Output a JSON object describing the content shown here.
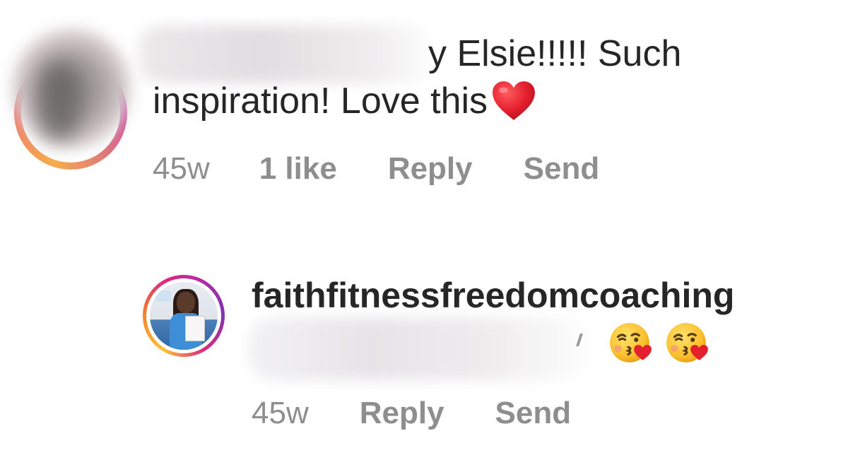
{
  "comments": [
    {
      "text_line1": "y Elsie!!!!! Such",
      "text_line2": "inspiration! Love this",
      "emoji": "red-heart",
      "time": "45w",
      "likes": "1 like",
      "reply_label": "Reply",
      "send_label": "Send"
    },
    {
      "username": "faithfitnessfreedomcoaching",
      "emojis": [
        "kissing-face-with-heart",
        "kissing-face-with-heart"
      ],
      "time": "45w",
      "reply_label": "Reply",
      "send_label": "Send"
    }
  ],
  "colors": {
    "text": "#262626",
    "meta": "#8e8e8e",
    "heart": "#e5202e",
    "story_ring": [
      "#f9c23c",
      "#dd2a7b",
      "#8134af"
    ]
  }
}
